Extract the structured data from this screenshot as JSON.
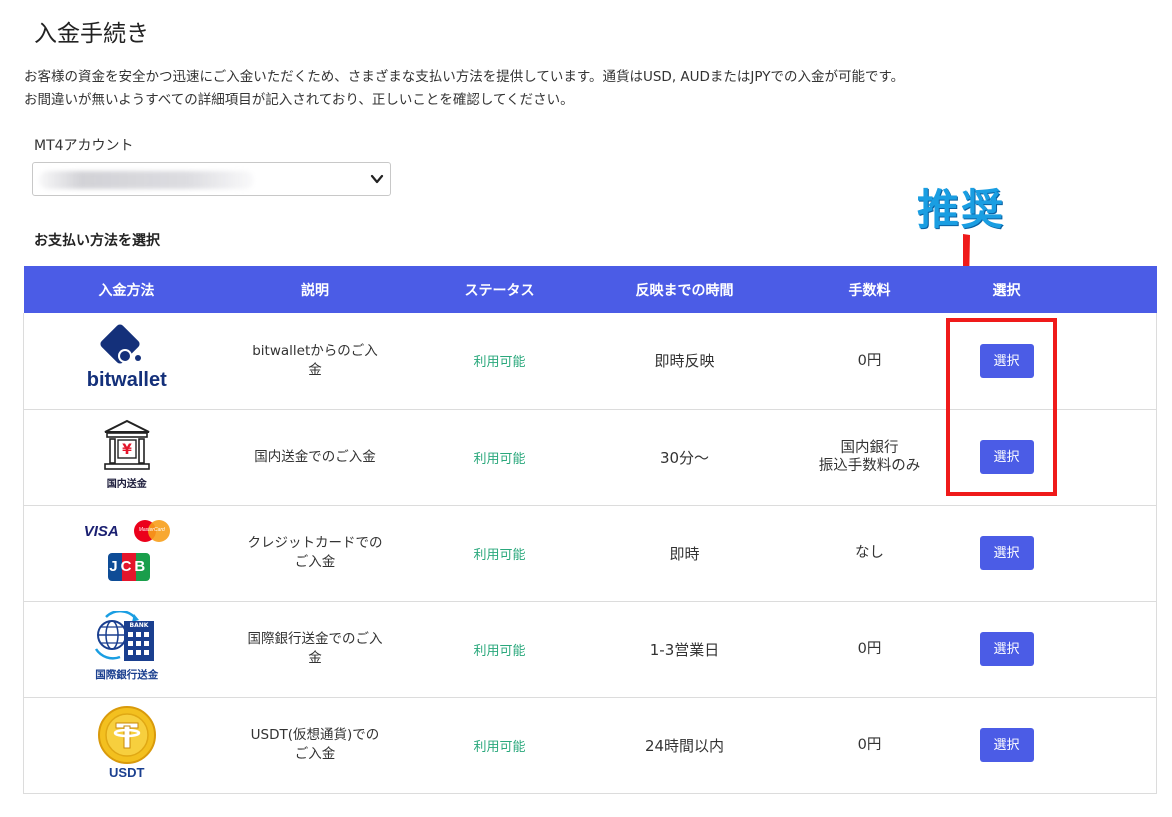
{
  "page": {
    "title": "入金手続き",
    "intro_line1": "お客様の資金を安全かつ迅速にご入金いただくため、さまざまな支払い方法を提供しています。通貨はUSD, AUDまたはJPYでの入金が可能です。",
    "intro_line2": "お間違いが無いようすべての詳細項目が記入されており、正しいことを確認してください。"
  },
  "account": {
    "label": "MT4アカウント"
  },
  "payment": {
    "section_label": "お支払い方法を選択",
    "headers": {
      "method": "入金方法",
      "desc": "説明",
      "status": "ステータス",
      "time": "反映までの時間",
      "fee": "手数料",
      "select": "選択"
    },
    "rows": [
      {
        "logo": "bitwallet-logo",
        "logo_text": "bitwallet",
        "desc": "bitwalletからのご入金",
        "status": "利用可能",
        "time": "即時反映",
        "fee_line1": "0円",
        "fee_line2": "",
        "button": "選択"
      },
      {
        "logo": "domestic-bank-icon",
        "logo_text": "国内送金",
        "desc": "国内送金でのご入金",
        "status": "利用可能",
        "time": "30分〜",
        "fee_line1": "国内銀行",
        "fee_line2": "振込手数料のみ",
        "button": "選択"
      },
      {
        "logo": "credit-card-logos",
        "logo_text": "VISA",
        "logo_text2": "MasterCard",
        "logo_text3": "JCB",
        "desc": "クレジットカードでのご入金",
        "status": "利用可能",
        "time": "即時",
        "fee_line1": "なし",
        "fee_line2": "",
        "button": "選択"
      },
      {
        "logo": "international-bank-icon",
        "logo_text": "国際銀行送金",
        "logo_text2": "BANK",
        "desc": "国際銀行送金でのご入金",
        "status": "利用可能",
        "time": "1-3営業日",
        "fee_line1": "0円",
        "fee_line2": "",
        "button": "選択"
      },
      {
        "logo": "usdt-coin-icon",
        "logo_text": "USDT",
        "desc": "USDT(仮想通貨)でのご入金",
        "status": "利用可能",
        "time": "24時間以内",
        "fee_line1": "0円",
        "fee_line2": "",
        "button": "選択"
      }
    ]
  },
  "annotation": {
    "text": "推奨"
  },
  "colors": {
    "header_bg": "#4b5ce6",
    "button_bg": "#4b5ce6",
    "status": "#2aa87c",
    "highlight": "#ef1a1a",
    "annotation": "#1a9ee2"
  }
}
